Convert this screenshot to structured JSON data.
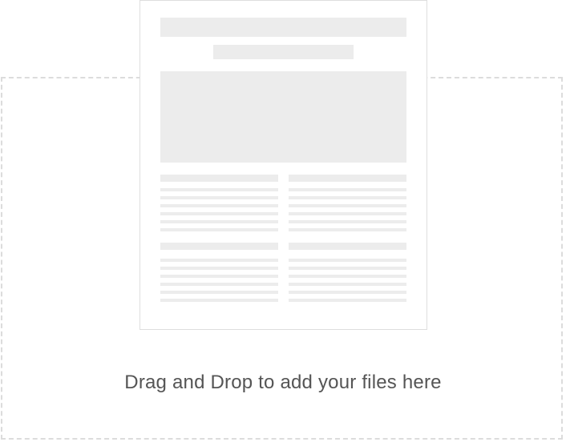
{
  "dropzone": {
    "label": "Drag and Drop to add your files here",
    "icon": "document-preview-icon",
    "border_color": "#dcdcdc",
    "placeholder_color": "#ececec",
    "text_color": "#555555"
  }
}
